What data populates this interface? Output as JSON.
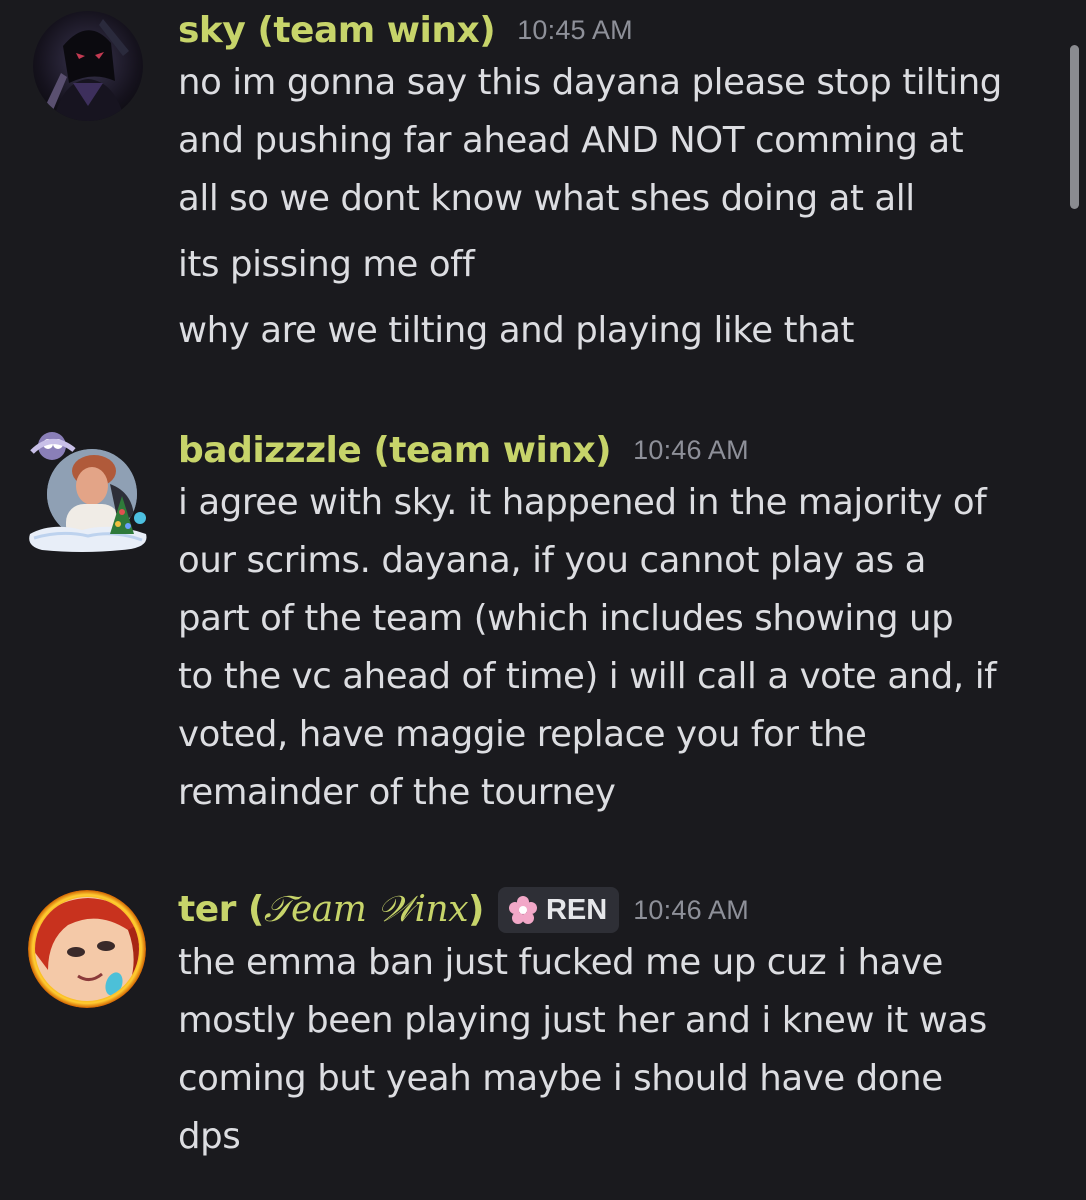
{
  "colors": {
    "background": "#1a1a1e",
    "username": "#c7d46a",
    "text": "#dcdde1",
    "timestamp": "#8e9099",
    "tag_bg": "#2e2f36"
  },
  "messages": [
    {
      "username": "sky (team winx)",
      "timestamp": "10:45 AM",
      "avatar_icon": "user-avatar-dark-figure",
      "lines": [
        "no im gonna say this dayana please stop tilting",
        "and pushing far ahead AND NOT comming at",
        "all so we dont know what shes doing at all",
        "its pissing me off",
        "why are we tilting and playing like that"
      ]
    },
    {
      "username": "badizzzle (team winx)",
      "timestamp": "10:46 AM",
      "avatar_icon": "user-avatar-festive-decoration",
      "lines": [
        "i agree with sky. it happened in the majority of",
        "our scrims. dayana, if you cannot play as a",
        "part of the team (which includes showing up",
        "to the vc ahead of time) i will call a vote and, if",
        "voted, have maggie replace you for the",
        "remainder of the tourney"
      ]
    },
    {
      "username_prefix": "ter (",
      "username_fancy": "𝒯eam 𝒲inx",
      "username_suffix": ")",
      "tag_icon": "flower-icon",
      "tag_label": "REN",
      "timestamp": "10:46 AM",
      "avatar_icon": "user-avatar-red-hair-portrait",
      "lines": [
        "the emma ban just fucked me up cuz i have",
        "mostly been playing just her and i knew it was",
        "coming but yeah maybe i should have done",
        "dps"
      ]
    }
  ]
}
